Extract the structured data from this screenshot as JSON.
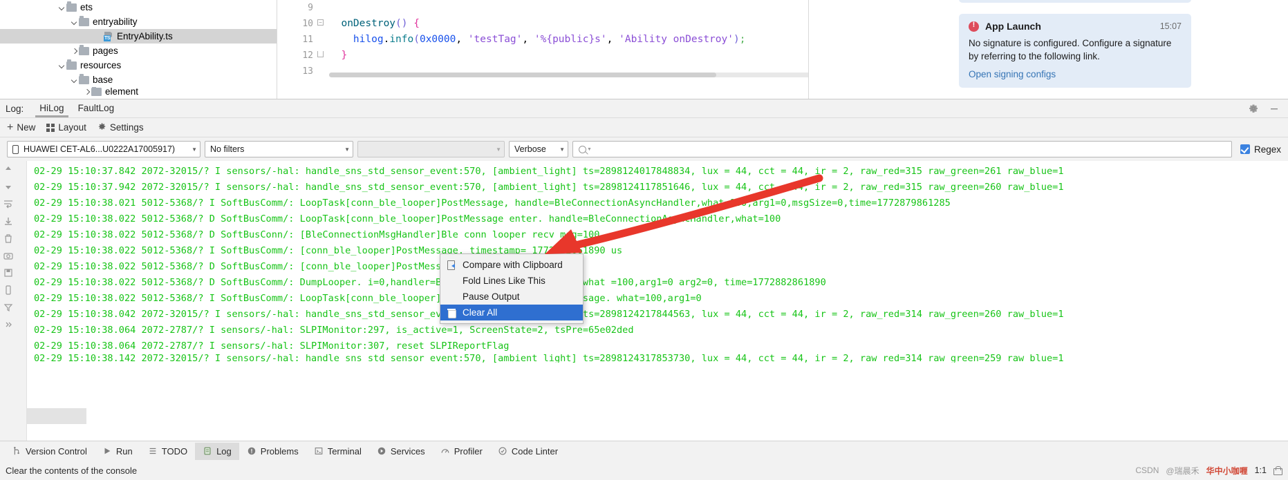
{
  "project_tree": {
    "items": [
      {
        "label": "ets",
        "indent": 1,
        "chevron": "down",
        "icon": "folder-icon",
        "selected": false
      },
      {
        "label": "entryability",
        "indent": 2,
        "chevron": "down",
        "icon": "folder-icon",
        "selected": false
      },
      {
        "label": "EntryAbility.ts",
        "indent": 3,
        "chevron": "none",
        "icon": "typescript-file-icon",
        "selected": true
      },
      {
        "label": "pages",
        "indent": 2,
        "chevron": "right",
        "icon": "folder-icon",
        "selected": false
      },
      {
        "label": "resources",
        "indent": 1,
        "chevron": "down",
        "icon": "folder-icon",
        "selected": false
      },
      {
        "label": "base",
        "indent": 2,
        "chevron": "down",
        "icon": "folder-icon",
        "selected": false
      },
      {
        "label": "element",
        "indent": 3,
        "chevron": "right",
        "icon": "folder-icon",
        "selected": false
      }
    ]
  },
  "editor": {
    "line_numbers": [
      "9",
      "10",
      "11",
      "12",
      "13"
    ],
    "code_lines": [
      {
        "tokens": []
      },
      {
        "tokens": [
          {
            "t": "  ",
            "c": "k-obj"
          },
          {
            "t": "onDestroy",
            "c": "k-fn"
          },
          {
            "t": "() ",
            "c": "k-paren"
          },
          {
            "t": "{",
            "c": "k-punct"
          }
        ]
      },
      {
        "tokens": [
          {
            "t": "    ",
            "c": "k-obj"
          },
          {
            "t": "hilog",
            "c": "k-num"
          },
          {
            "t": ".",
            "c": "k-obj"
          },
          {
            "t": "info",
            "c": "k-mth"
          },
          {
            "t": "(",
            "c": "k-paren"
          },
          {
            "t": "0x0000",
            "c": "k-num"
          },
          {
            "t": ", ",
            "c": "k-obj"
          },
          {
            "t": "'testTag'",
            "c": "k-str"
          },
          {
            "t": ", ",
            "c": "k-obj"
          },
          {
            "t": "'%{public}s'",
            "c": "k-str"
          },
          {
            "t": ", ",
            "c": "k-obj"
          },
          {
            "t": "'Ability onDestroy'",
            "c": "k-str"
          },
          {
            "t": ")",
            "c": "k-paren"
          },
          {
            "t": ";",
            "c": "k-semi"
          }
        ]
      },
      {
        "tokens": [
          {
            "t": "  ",
            "c": "k-obj"
          },
          {
            "t": "}",
            "c": "k-punct"
          }
        ]
      },
      {
        "tokens": []
      }
    ]
  },
  "notification": {
    "icon": "error-icon",
    "title": "App Launch",
    "time": "15:07",
    "body": "No signature is configured. Configure a signature by referring to the following link.",
    "link": "Open signing configs"
  },
  "log_panel": {
    "log_label": "Log:",
    "tabs": [
      {
        "label": "HiLog",
        "active": true
      },
      {
        "label": "FaultLog",
        "active": false
      }
    ],
    "header_icons": [
      "gear-icon",
      "minimize-icon"
    ],
    "toolbar": [
      {
        "label": "New",
        "icon": "plus-icon"
      },
      {
        "label": "Layout",
        "icon": "layout-grid-icon"
      },
      {
        "label": "Settings",
        "icon": "gear-icon"
      }
    ],
    "filters": {
      "device": "HUAWEI CET-AL6...U0222A17005917)",
      "device_icon": "phone-icon",
      "filter": "No filters",
      "process": "",
      "level": "Verbose",
      "search_value": "",
      "search_placeholder": "",
      "regex_label": "Regex",
      "regex_checked": true,
      "accent_color": "#3b82e0"
    },
    "side_tools": [
      "scroll-up-icon",
      "scroll-down-icon",
      "wrap-lines-icon",
      "scroll-to-end-icon",
      "trash-icon",
      "camera-icon",
      "save-icon",
      "device-icon",
      "filter-icon",
      "expand-icon"
    ],
    "lines": [
      "02-29 15:10:37.842 2072-32015/? I sensors/-hal: handle_sns_std_sensor_event:570, [ambient_light] ts=2898124017848834, lux = 44, cct = 44, ir = 2, raw_red=315 raw_green=261 raw_blue=1",
      "02-29 15:10:37.942 2072-32015/? I sensors/-hal: handle_sns_std_sensor_event:570, [ambient_light] ts=2898124117851646, lux = 44, cct = 44, ir = 2, raw_red=315 raw_green=260 raw_blue=1",
      "02-29 15:10:38.021 5012-5368/? I SoftBusComm/: LoopTask[conn_ble_looper]PostMessage, handle=BleConnectionAsyncHandler,what=100,arg1=0,msgSize=0,time=1772879861285",
      "02-29 15:10:38.022 5012-5368/? D SoftBusComm/: LoopTask[conn_ble_looper]PostMessage enter. handle=BleConnectionAsyncHandler,what=100",
      "02-29 15:10:38.022 5012-5368/? D SoftBusConn/: [BleConnectionMsgHandler]Ble conn looper recv msg=100",
      "02-29 15:10:38.022 5012-5368/? I SoftBusComm/: [conn_ble_looper]PostMessage, timestamp= 1772882861890 us",
      "02-29 15:10:38.022 5012-5368/? D SoftBusComm/: [conn_ble_looper]PostMessageAtTime. insert",
      "02-29 15:10:38.022 5012-5368/? D SoftBusComm/: DumpLooper. i=0,handler=BleConnectionAsyncHandler,what =100,arg1=0 arg2=0, time=1772882861890",
      "02-29 15:10:38.022 5012-5368/? I SoftBusComm/: LoopTask[conn_ble_looper], after HandleMessage message. what=100,arg1=0",
      "02-29 15:10:38.042 2072-32015/? I sensors/-hal: handle_sns_std_sensor_event:570, [ambient_light] ts=2898124217844563, lux = 44, cct = 44, ir = 2, raw_red=314 raw_green=260 raw_blue=1",
      "02-29 15:10:38.064 2072-2787/? I sensors/-hal: SLPIMonitor:297, is_active=1, ScreenState=2, tsPre=65e02ded",
      "02-29 15:10:38.064 2072-2787/? I sensors/-hal: SLPIMonitor:307, reset SLPIReportFlag",
      "02-29 15:10:38.142 2072-32015/? I sensors/-hal: handle_sns_std_sensor_event:570, [ambient_light] ts=2898124317853730, lux = 44, cct = 44, ir = 2, raw_red=314 raw_green=259 raw_blue=1"
    ],
    "log_text_color": "#17c417"
  },
  "context_menu": {
    "items": [
      {
        "label": "Compare with Clipboard",
        "icon": "clipboard-compare-icon",
        "highlighted": false
      },
      {
        "label": "Fold Lines Like This",
        "icon": "none",
        "highlighted": false
      },
      {
        "label": "Pause Output",
        "icon": "none",
        "highlighted": false
      },
      {
        "label": "Clear All",
        "icon": "trash-icon",
        "highlighted": true
      }
    ],
    "highlight_color": "#2f6fd0"
  },
  "bottom_bar": {
    "items": [
      {
        "label": "Version Control",
        "icon": "branch-icon",
        "active": false
      },
      {
        "label": "Run",
        "icon": "play-icon",
        "active": false
      },
      {
        "label": "TODO",
        "icon": "list-icon",
        "active": false
      },
      {
        "label": "Log",
        "icon": "log-icon",
        "active": true
      },
      {
        "label": "Problems",
        "icon": "warning-icon",
        "active": false
      },
      {
        "label": "Terminal",
        "icon": "terminal-icon",
        "active": false
      },
      {
        "label": "Services",
        "icon": "services-icon",
        "active": false
      },
      {
        "label": "Profiler",
        "icon": "profiler-icon",
        "active": false
      },
      {
        "label": "Code Linter",
        "icon": "linter-icon",
        "active": false
      }
    ]
  },
  "status_bar": {
    "text": "Clear the contents of the console",
    "watermark_left": "CSDN",
    "watermark_mid": "@瑞晨禾",
    "watermark_right": "华中小咖喱",
    "ratio": "1:1",
    "lock_icon": "lock-icon"
  }
}
